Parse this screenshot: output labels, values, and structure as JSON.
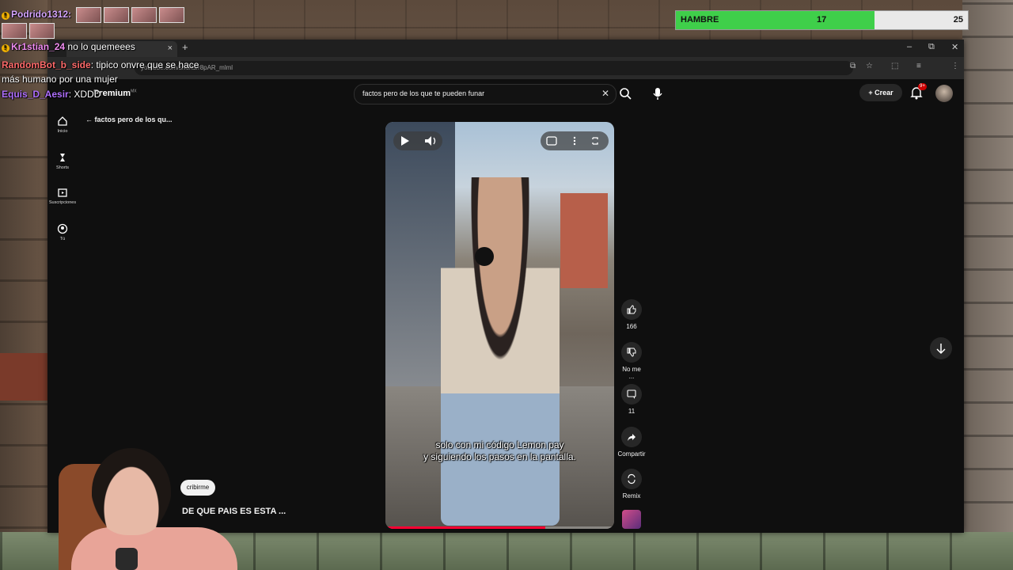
{
  "hunger": {
    "label": "HAMBRE",
    "value": "17",
    "max": "25",
    "fill_fraction": 0.68
  },
  "chat": [
    {
      "user": "Podrido1312:",
      "color": "#d7a6ff",
      "msg": ""
    },
    {
      "user": "Kr1stian_24",
      "color": "#f08cf0",
      "msg": "no lo quemeees"
    },
    {
      "user": "RandomBot_b_side",
      "color": "#ff6b6b",
      "msg": ": tipico onvre que se hace más humano por una mujer"
    },
    {
      "user": "Equis_D_Aesir",
      "color": "#b070ff",
      "msg": ": XDDD"
    }
  ],
  "browser": {
    "tab_label": "",
    "new_tab": "+",
    "url": "youtube.com/shorts/r8pAR_mlml",
    "minimize": "–",
    "restore": "⧉",
    "close": "✕"
  },
  "yt": {
    "logo": "Premium",
    "logo_region": "MX",
    "search_query": "factos pero de los que te pueden funar",
    "create_label": "Crear",
    "notif_count": "9+",
    "back_label": "factos pero de los qu..."
  },
  "sidebar": [
    {
      "label": "Inicio",
      "icon": "home-icon"
    },
    {
      "label": "Shorts",
      "icon": "shorts-icon"
    },
    {
      "label": "Suscripciones",
      "icon": "subscriptions-icon"
    },
    {
      "label": "Tú",
      "icon": "you-icon"
    }
  ],
  "video": {
    "subtitle_line1": "solo con mi código Lemon pay",
    "subtitle_line2": "y siguiendo los pasos en la pantalla.",
    "progress_fraction": 0.7
  },
  "actions": {
    "like_count": "166",
    "dislike_label": "No me ...",
    "comments_count": "11",
    "share_label": "Compartir",
    "remix_label": "Remix"
  },
  "channel": {
    "subscribe_label": "cribirme",
    "video_title": "DE QUE PAIS ES ESTA ..."
  }
}
